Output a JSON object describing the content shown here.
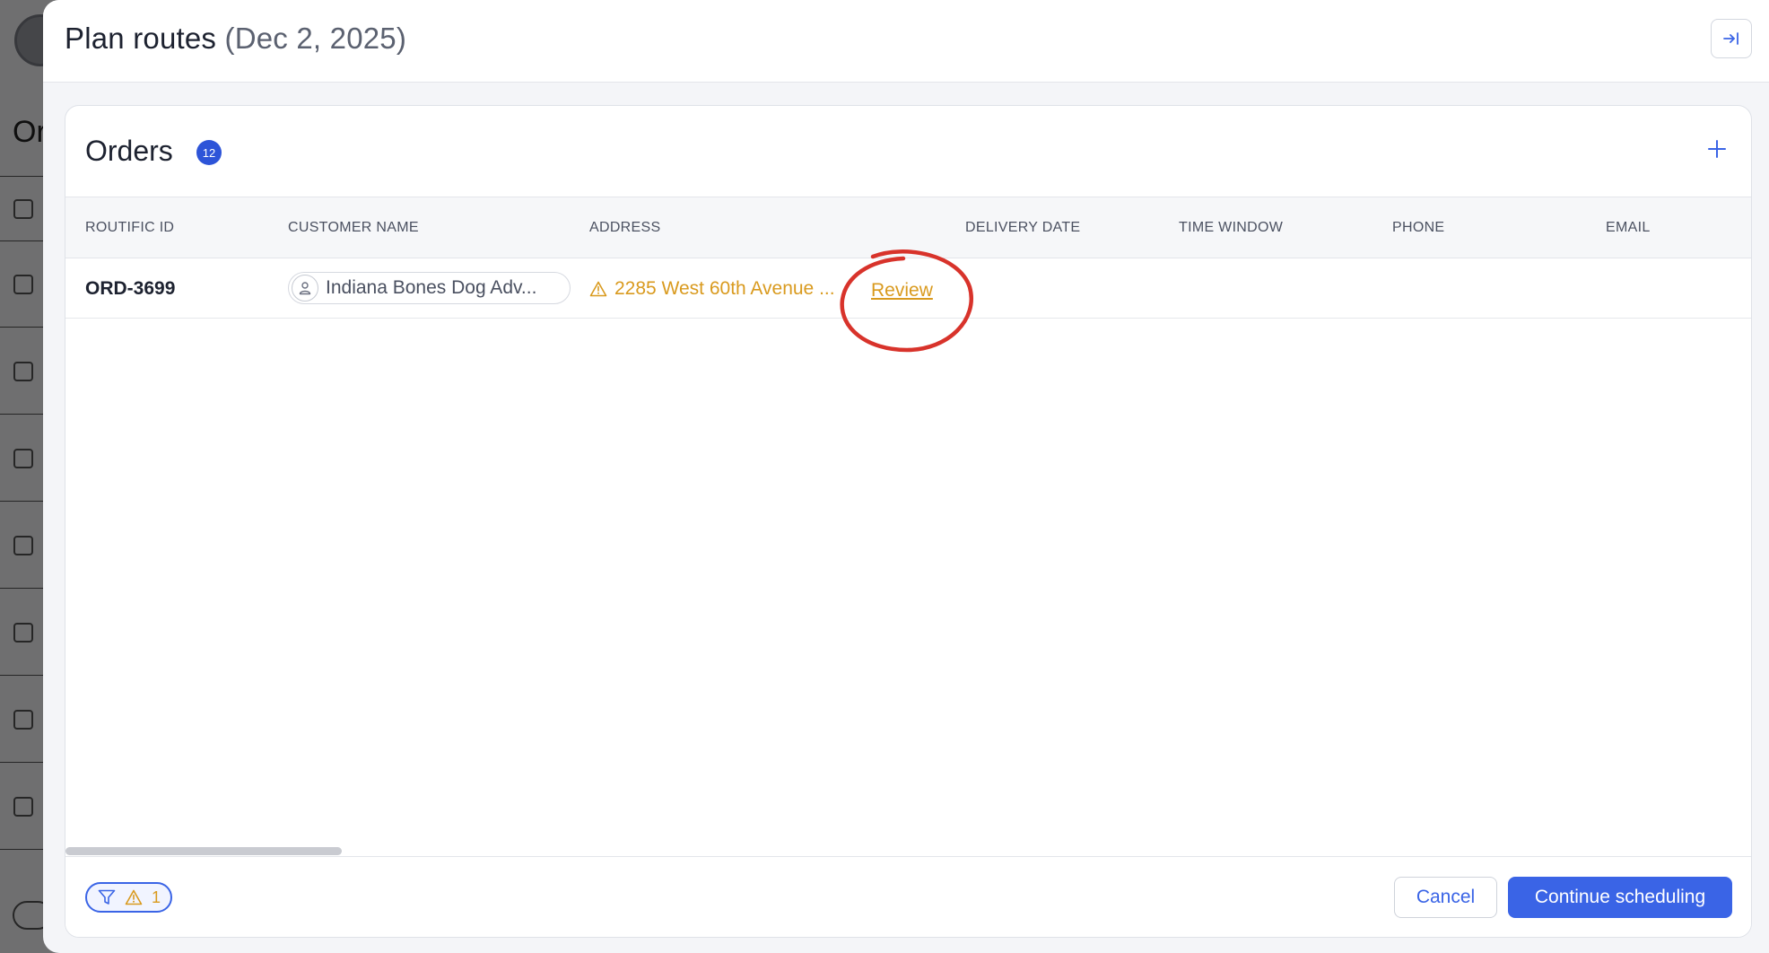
{
  "background": {
    "heading": "Or"
  },
  "modal": {
    "title": "Plan routes",
    "date": "(Dec 2, 2025)",
    "collapse_icon": "collapse-right-icon"
  },
  "orders": {
    "title": "Orders",
    "count": "12",
    "add_icon": "plus-icon",
    "columns": [
      "ROUTIFIC ID",
      "CUSTOMER NAME",
      "ADDRESS",
      "DELIVERY DATE",
      "TIME WINDOW",
      "PHONE",
      "EMAIL"
    ],
    "rows": [
      {
        "id": "ORD-3699",
        "customer": "Indiana Bones Dog Adv...",
        "address": "2285 West 60th Avenue ...",
        "address_status": "warning",
        "review_label": "Review",
        "delivery_date": "",
        "time_window": "",
        "phone": "",
        "email": ""
      }
    ]
  },
  "footer": {
    "warning_count": "1",
    "cancel_label": "Cancel",
    "continue_label": "Continue scheduling"
  },
  "colors": {
    "accent": "#3a64e6",
    "warning": "#d99a1e",
    "annotation": "#d8332b"
  }
}
